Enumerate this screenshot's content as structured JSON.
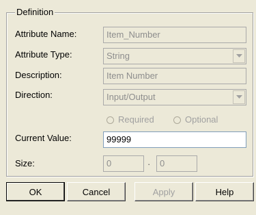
{
  "definition": {
    "title": "Definition",
    "attribute_name": {
      "label": "Attribute Name:",
      "value": "Item_Number"
    },
    "attribute_type": {
      "label": "Attribute Type:",
      "value": "String"
    },
    "description": {
      "label": "Description:",
      "value": "Item Number"
    },
    "direction": {
      "label": "Direction:",
      "value": "Input/Output"
    },
    "required_label": "Required",
    "optional_label": "Optional",
    "current_value": {
      "label": "Current Value:",
      "value": "99999"
    },
    "size": {
      "label": "Size:",
      "from": "0",
      "separator": "·",
      "to": "0"
    }
  },
  "buttons": {
    "ok": "OK",
    "cancel": "Cancel",
    "apply": "Apply",
    "help": "Help"
  }
}
